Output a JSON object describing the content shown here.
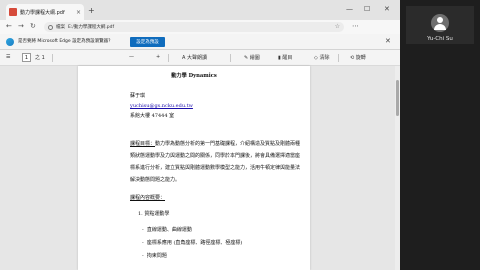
{
  "browser": {
    "tab_title": "動力學課程大綱.pdf",
    "tab_close": "×",
    "new_tab": "+",
    "window_controls": {
      "minimize": "—",
      "maximize": "☐",
      "close": "✕"
    }
  },
  "address_bar": {
    "back": "←",
    "forward": "→",
    "refresh": "↻",
    "site_label": "檔案",
    "url": "E:/動力學課程大綱.pdf",
    "menu": "⋯"
  },
  "infobar": {
    "text": "是否要將 Microsoft Edge 設定為預設瀏覽器？",
    "button": "設定為預設",
    "close": "✕"
  },
  "pdf_toolbar": {
    "menu": "☰",
    "page_current": "1",
    "page_total": "之 1",
    "zoom_out": "—",
    "zoom_in": "+",
    "read_aloud": "大聲朗讀",
    "draw": "繪圖",
    "highlight": "醒目",
    "erase": "清除",
    "rotate": "旋轉"
  },
  "document": {
    "title": "動力學 Dynamics",
    "teacher": "蘇于琪",
    "email": "yuchisu@gs.ncku.edu.tw",
    "office": "系館大樓 47444 室",
    "goal_label": "課程目標：",
    "goal_line1": "動力學為動態分析的第一門基礎課程，介紹構造及質點及剛體兩種",
    "goal_line2": "類狀態運動學及力與運動之間的關係，同學於本門課後，將會具備選擇適當座",
    "goal_line3": "標系進行分析，建立質點與剛體運動數學模型之能力，活用牛頓定律與能量法",
    "goal_line4": "解決動態問題之能力。",
    "content_label": "課程內容概要：",
    "section1": "1. 質點運動學",
    "item1": "直線運動、曲線運動",
    "item2": "座標系應用 (直角座標、路徑座標、極座標)",
    "item3": "拘束問題"
  },
  "participant": {
    "name": "Yu-Chi Su"
  }
}
